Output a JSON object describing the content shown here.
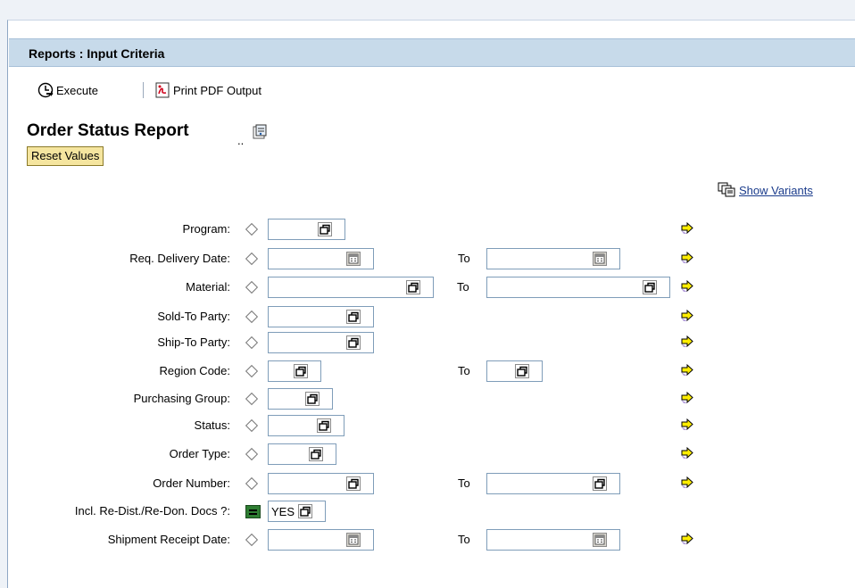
{
  "header": {
    "title": "Reports : Input Criteria"
  },
  "toolbar": {
    "execute_label": "Execute",
    "print_label": "Print PDF Output"
  },
  "page": {
    "title": "Order Status Report",
    "reset_label": "Reset Values",
    "variants_label": "Show Variants"
  },
  "to_label": "To",
  "fields": [
    {
      "label": "Program:",
      "op": "diamond",
      "from_value": "",
      "help": "select",
      "to": false
    },
    {
      "label": "Req. Delivery Date:",
      "op": "diamond",
      "from_value": "",
      "help": "calendar",
      "to": true,
      "to_value": "",
      "to_help": "calendar"
    },
    {
      "label": "Material:",
      "op": "diamond",
      "from_value": "",
      "help": "select",
      "to": true,
      "to_value": "",
      "to_help": "select"
    },
    {
      "label": "Sold-To Party:",
      "op": "diamond",
      "from_value": "",
      "help": "select",
      "to": false
    },
    {
      "label": "Ship-To Party:",
      "op": "diamond",
      "from_value": "",
      "help": "select",
      "to": false
    },
    {
      "label": "Region Code:",
      "op": "diamond",
      "from_value": "",
      "help": "select",
      "to": true,
      "to_value": "",
      "to_help": "select"
    },
    {
      "label": "Purchasing Group:",
      "op": "diamond",
      "from_value": "",
      "help": "select",
      "to": false
    },
    {
      "label": "Status:",
      "op": "diamond",
      "from_value": "",
      "help": "select",
      "to": false
    },
    {
      "label": "Order Type:",
      "op": "diamond",
      "from_value": "",
      "help": "select",
      "to": false
    },
    {
      "label": "Order Number:",
      "op": "diamond",
      "from_value": "",
      "help": "select",
      "to": true,
      "to_value": "",
      "to_help": "select"
    },
    {
      "label": "Incl. Re-Dist./Re-Don. Docs ?:",
      "op": "equals",
      "from_value": "YES",
      "help": "select",
      "to": false
    },
    {
      "label": "Shipment Receipt Date:",
      "op": "diamond",
      "from_value": "",
      "help": "calendar",
      "to": true,
      "to_value": "",
      "to_help": "calendar"
    }
  ],
  "icons": {
    "execute": "execute-clock-icon",
    "print": "pdf-icon",
    "title": "info-doc-icon",
    "variants": "variants-icon",
    "select": "select-options-icon",
    "calendar": "calendar-icon",
    "multiple": "multiple-selection-arrow-icon"
  },
  "colors": {
    "titlebar": "#c7daea",
    "reset": "#f5e59f",
    "link": "#1b3c8c",
    "arrow": "#ffee00"
  }
}
